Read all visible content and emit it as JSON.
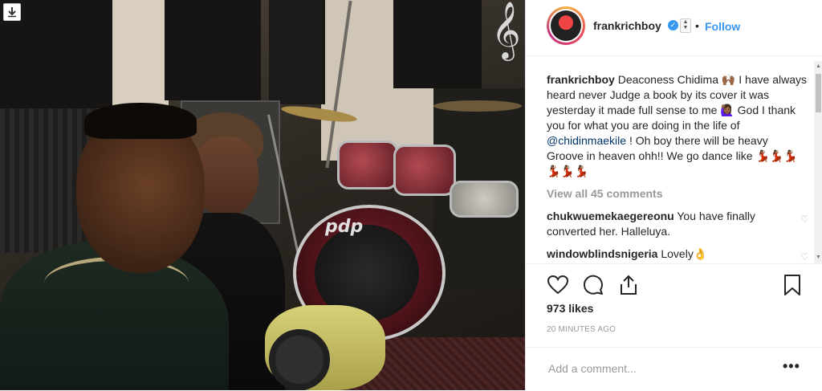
{
  "post": {
    "username": "frankrichboy",
    "follow_label": "Follow",
    "separator": "•",
    "caption_username": "frankrichboy",
    "caption_part1": "Deaconess Chidima 🙌🏾 I have always heard never Judge a book by its cover it was yesterday it made full sense to me 🙋🏾‍♀️ God I thank you for what you are doing in the life of",
    "caption_mention": "@chidinmaekile",
    "caption_part2": "! Oh boy there will be heavy Groove in heaven ohh!! We go dance like 💃🏾💃🏾💃🏾💃🏾💃🏾💃🏾",
    "view_all": "View all 45 comments",
    "comments": [
      {
        "username": "chukwuemekaegereonu",
        "text": "You have finally converted her. Halleluya."
      },
      {
        "username": "windowblindsnigeria",
        "text": "Lovely👌"
      }
    ],
    "likes": "973 likes",
    "time": "20 MINUTES AGO",
    "add_comment_placeholder": "Add a comment...",
    "more_label": "•••"
  },
  "photo": {
    "drum_logo": "pdp",
    "clef_glyph": "𝄞"
  },
  "icons": {
    "download": "down-arrow-icon",
    "verified": "verified-badge-icon",
    "like": "heart-icon",
    "comment": "comment-bubble-icon",
    "share": "share-icon",
    "save": "bookmark-icon"
  },
  "colors": {
    "accent": "#3897f0",
    "text": "#262626",
    "muted": "#999999"
  }
}
